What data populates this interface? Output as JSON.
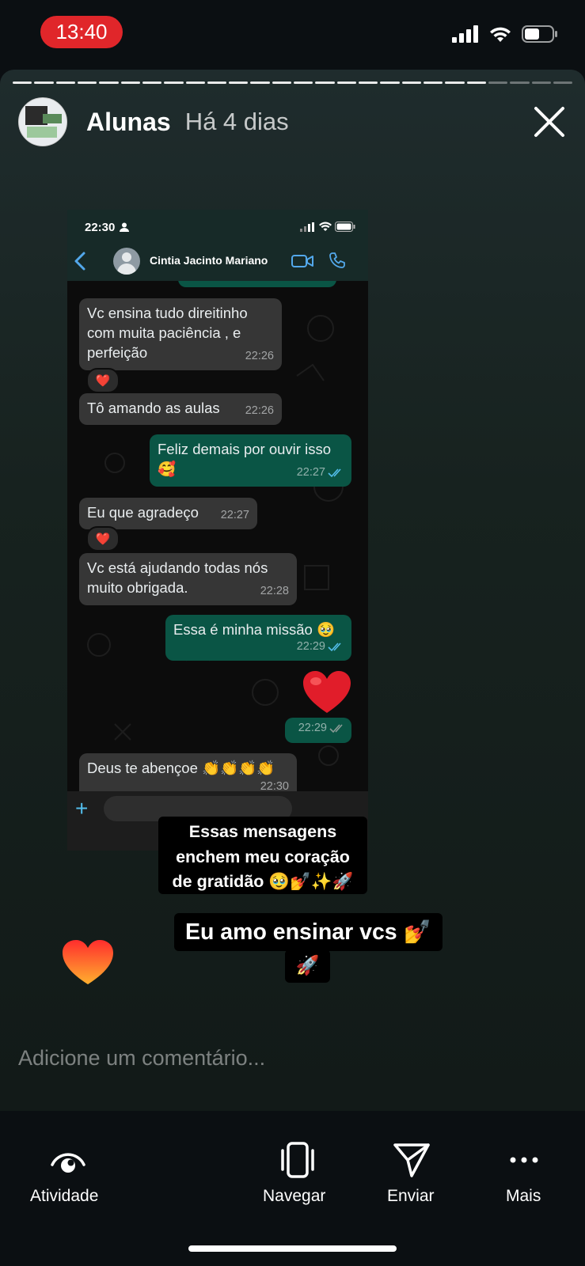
{
  "status_bar": {
    "time": "13:40"
  },
  "story": {
    "account_name": "Alunas",
    "posted_ago": "Há 4 dias",
    "progress_segments_total": 26,
    "progress_segments_viewed": 22
  },
  "whatsapp": {
    "status_time": "22:30",
    "contact_name": "Cintia Jacinto Mariano",
    "messages": [
      {
        "dir": "in",
        "lines": [
          "Vc ensina tudo direitinho",
          "com muita paciência , e",
          "perfeição"
        ],
        "time": "22:26",
        "reaction": "❤️"
      },
      {
        "dir": "in",
        "lines": [
          "Tô amando as aulas"
        ],
        "time": "22:26"
      },
      {
        "dir": "out",
        "lines": [
          "Feliz demais por ouvir isso",
          "🥰"
        ],
        "time": "22:27"
      },
      {
        "dir": "in",
        "lines": [
          "Eu que agradeço"
        ],
        "time": "22:27",
        "reaction": "❤️"
      },
      {
        "dir": "in",
        "lines": [
          "Vc está ajudando todas nós",
          "muito obrigada."
        ],
        "time": "22:28"
      },
      {
        "dir": "out",
        "lines": [
          "Essa é minha missão 🥹"
        ],
        "time": "22:29"
      },
      {
        "dir": "out",
        "lines": [
          "❤️"
        ],
        "time": "22:29"
      },
      {
        "dir": "in",
        "lines": [
          "Deus te abençoe 👏👏👏👏"
        ],
        "time": "22:30"
      }
    ]
  },
  "stickers": {
    "gratitude_lines": [
      "Essas mensagens",
      "enchem meu coração",
      "de gratidão 🥹💅✨🚀"
    ],
    "love_line": "Eu amo ensinar vcs 💅",
    "rocket": "🚀"
  },
  "comment_placeholder": "Adicione um comentário...",
  "nav": {
    "activity": "Atividade",
    "browse": "Navegar",
    "send": "Enviar",
    "more": "Mais"
  }
}
